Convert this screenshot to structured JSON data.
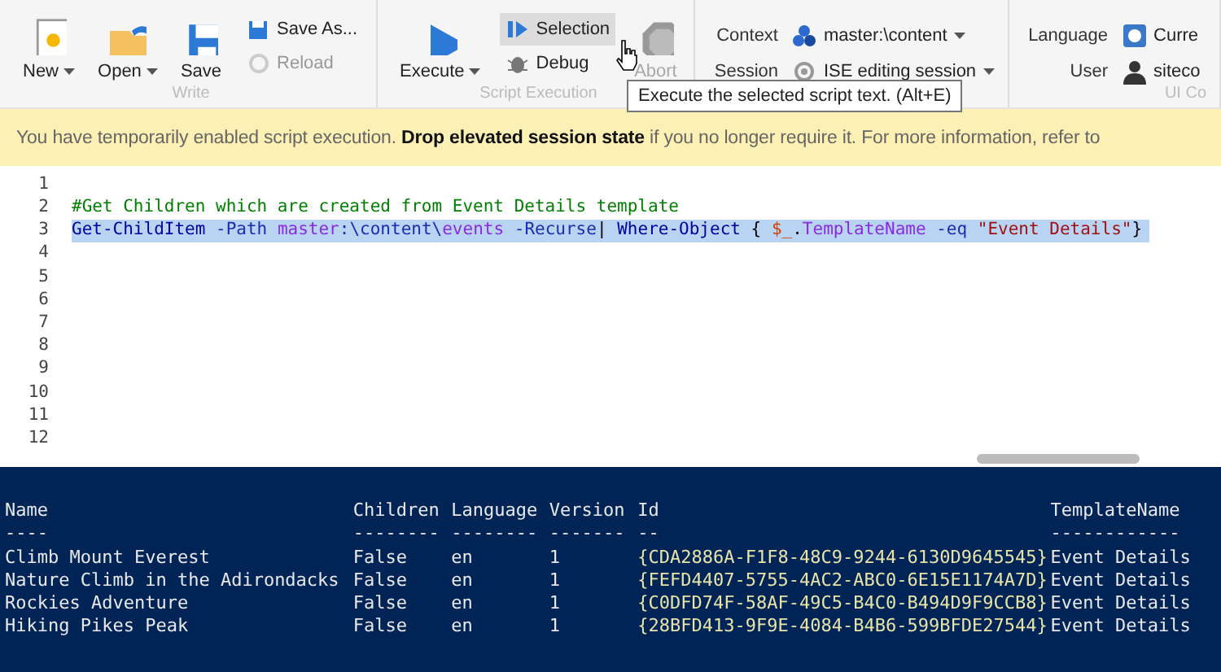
{
  "toolbar": {
    "groups": [
      {
        "label": "Write",
        "buttons": [
          {
            "kind": "large",
            "label": "New",
            "dropdown": true,
            "disabled": false
          },
          {
            "kind": "large",
            "label": "Open",
            "dropdown": true,
            "disabled": false
          },
          {
            "kind": "large",
            "label": "Save",
            "dropdown": false,
            "disabled": false
          },
          {
            "kind": "small",
            "label": "Save As...",
            "disabled": false,
            "hovered": false
          },
          {
            "kind": "small",
            "label": "Reload",
            "disabled": true,
            "hovered": false
          }
        ]
      },
      {
        "label": "Script Execution",
        "buttons": [
          {
            "kind": "large",
            "label": "Execute",
            "dropdown": true,
            "disabled": false
          },
          {
            "kind": "small",
            "label": "Selection",
            "disabled": false,
            "hovered": true
          },
          {
            "kind": "small",
            "label": "Debug",
            "disabled": false,
            "hovered": false
          },
          {
            "kind": "large",
            "label": "Abort",
            "dropdown": false,
            "disabled": true
          }
        ]
      },
      {
        "fields": [
          {
            "label": "Context",
            "value": "master:\\content"
          },
          {
            "label": "Session",
            "value": "ISE editing session"
          }
        ]
      },
      {
        "label": "UI Co",
        "fields": [
          {
            "label": "Language",
            "value": "Curre"
          },
          {
            "label": "User",
            "value": "siteco"
          }
        ]
      }
    ]
  },
  "tooltip": "Execute the selected script text. (Alt+E)",
  "banner": {
    "before": "You have temporarily enabled script execution. ",
    "link": "Drop elevated session state",
    "after": " if you no longer require it. For more information, refer to"
  },
  "editor": {
    "lines": [
      {
        "number": "1",
        "selected": false
      },
      {
        "number": "2",
        "selected": false,
        "tokens": [
          {
            "text": "#Get Children which are created from Event Details template",
            "kind": "comment"
          }
        ]
      },
      {
        "number": "3",
        "selected": true,
        "tokens": [
          {
            "text": "Get-ChildItem",
            "kind": "command"
          },
          {
            "text": " -Path ",
            "kind": "parameter"
          },
          {
            "text": "master",
            "kind": "member"
          },
          {
            "text": ":\\content\\",
            "kind": "parameter"
          },
          {
            "text": "events",
            "kind": "member"
          },
          {
            "text": " -Recurse",
            "kind": "parameter"
          },
          {
            "text": "| ",
            "kind": "plain"
          },
          {
            "text": "Where-Object",
            "kind": "command"
          },
          {
            "text": " { ",
            "kind": "plain"
          },
          {
            "text": "$_",
            "kind": "variable"
          },
          {
            "text": ".",
            "kind": "plain"
          },
          {
            "text": "TemplateName",
            "kind": "member"
          },
          {
            "text": " -eq ",
            "kind": "parameter"
          },
          {
            "text": "\"Event Details\"",
            "kind": "string"
          },
          {
            "text": "}",
            "kind": "plain"
          }
        ]
      },
      {
        "number": "4",
        "selected": false
      },
      {
        "number": "5",
        "selected": false
      },
      {
        "number": "6",
        "selected": false
      },
      {
        "number": "7",
        "selected": false
      },
      {
        "number": "8",
        "selected": false
      },
      {
        "number": "9",
        "selected": false
      },
      {
        "number": "10",
        "selected": false
      },
      {
        "number": "11",
        "selected": false
      },
      {
        "number": "12",
        "selected": false
      }
    ]
  },
  "console": {
    "columns": [
      "Name",
      "Children",
      "Language",
      "Version",
      "Id",
      "TemplateName"
    ],
    "rules": [
      "----",
      "--------",
      "--------",
      "-------",
      "--",
      "------------"
    ],
    "rows": [
      [
        "Climb Mount Everest",
        "False",
        "en",
        "1",
        "{CDA2886A-F1F8-48C9-9244-6130D9645545}",
        "Event Details"
      ],
      [
        "Nature Climb in the Adirondacks",
        "False",
        "en",
        "1",
        "{FEFD4407-5755-4AC2-ABC0-6E15E1174A7D}",
        "Event Details"
      ],
      [
        "Rockies Adventure",
        "False",
        "en",
        "1",
        "{C0DFD74F-58AF-49C5-B4C0-B494D9F9CCB8}",
        "Event Details"
      ],
      [
        "Hiking Pikes Peak",
        "False",
        "en",
        "1",
        "{28BFD413-9F9E-4084-B4B6-599BFDE27544}",
        "Event Details"
      ]
    ]
  }
}
